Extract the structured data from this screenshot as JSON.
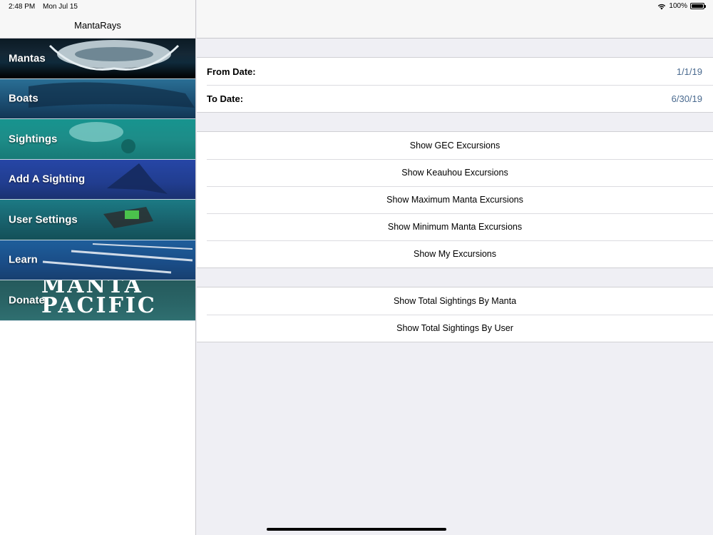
{
  "status_bar": {
    "time": "2:48 PM",
    "date": "Mon Jul 15",
    "battery": "100%"
  },
  "sidebar": {
    "title": "MantaRays",
    "items": [
      {
        "label": "Mantas"
      },
      {
        "label": "Boats"
      },
      {
        "label": "Sightings"
      },
      {
        "label": "Add A Sighting"
      },
      {
        "label": "User Settings"
      },
      {
        "label": "Learn"
      },
      {
        "label": "Donate"
      }
    ],
    "donate_logo_line1": "MANTA",
    "donate_logo_line2": "PACIFIC"
  },
  "main": {
    "dates": [
      {
        "label": "From Date:",
        "value": "1/1/19"
      },
      {
        "label": "To Date:",
        "value": "6/30/19"
      }
    ],
    "excursions": [
      "Show GEC Excursions",
      "Show Keauhou Excursions",
      "Show Maximum Manta Excursions",
      "Show Minimum Manta Excursions",
      "Show My Excursions"
    ],
    "sightings": [
      "Show Total Sightings By Manta",
      "Show Total Sightings By User"
    ]
  },
  "colors": {
    "date_value": "#4a6a8f",
    "background": "#efeff4"
  }
}
